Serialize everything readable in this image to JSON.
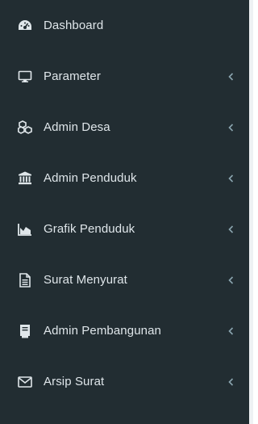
{
  "sidebar": {
    "items": [
      {
        "label": "Dashboard",
        "icon": "dashboard-icon",
        "has_submenu": false
      },
      {
        "label": "Parameter",
        "icon": "desktop-icon",
        "has_submenu": true
      },
      {
        "label": "Admin Desa",
        "icon": "cubes-icon",
        "has_submenu": true
      },
      {
        "label": "Admin Penduduk",
        "icon": "bank-icon",
        "has_submenu": true
      },
      {
        "label": "Grafik Penduduk",
        "icon": "area-chart-icon",
        "has_submenu": true
      },
      {
        "label": "Surat Menyurat",
        "icon": "file-text-icon",
        "has_submenu": true
      },
      {
        "label": "Admin Pembangunan",
        "icon": "book-icon",
        "has_submenu": true
      },
      {
        "label": "Arsip Surat",
        "icon": "envelope-icon",
        "has_submenu": true
      }
    ],
    "colors": {
      "background": "#222d32",
      "text": "#dfe6ea",
      "chevron": "#8aa4af"
    }
  }
}
